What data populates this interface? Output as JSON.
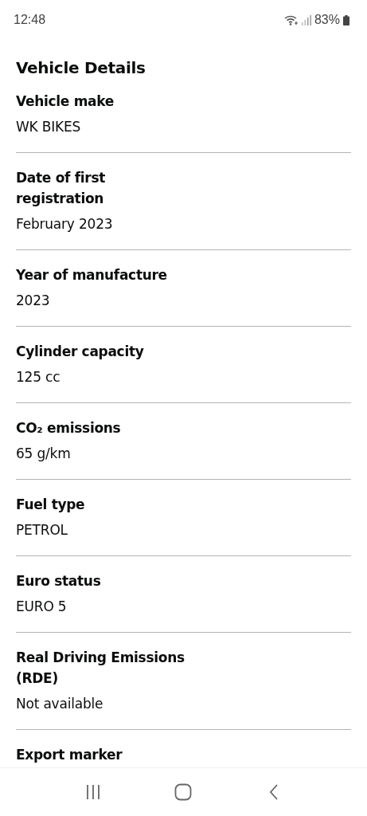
{
  "status_bar": {
    "time": "12:48",
    "battery": "83%"
  },
  "title": "Vehicle Details",
  "details": [
    {
      "label": "Vehicle make",
      "value": "WK BIKES"
    },
    {
      "label": "Date of first registration",
      "value": "February 2023"
    },
    {
      "label": "Year of manufacture",
      "value": "2023"
    },
    {
      "label": "Cylinder capacity",
      "value": "125 cc"
    },
    {
      "label": "CO₂ emissions",
      "value": "65 g/km"
    },
    {
      "label": "Fuel type",
      "value": "PETROL"
    },
    {
      "label": "Euro status",
      "value": "EURO 5"
    },
    {
      "label": "Real Driving Emissions (RDE)",
      "value": "Not available"
    },
    {
      "label": "Export marker"
    }
  ]
}
